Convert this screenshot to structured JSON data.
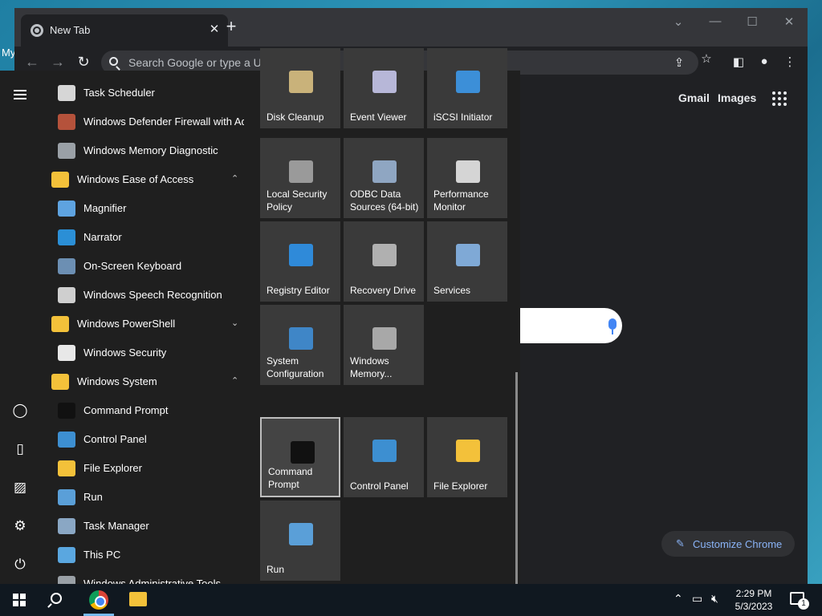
{
  "desktop": {
    "label": "My"
  },
  "browser": {
    "tab_title": "New Tab",
    "tab_close": "✕",
    "new_tab": "+",
    "omnibox_placeholder": "Search Google or type a URL",
    "gmail": "Gmail",
    "images": "Images",
    "customize": "Customize Chrome"
  },
  "start_menu": {
    "apps": [
      {
        "label": "Task Scheduler",
        "icon": "clock-icon",
        "color": "#d6d6d6"
      },
      {
        "label": "Windows Defender Firewall with Ad...",
        "icon": "firewall-icon",
        "color": "#b5523b"
      },
      {
        "label": "Windows Memory Diagnostic",
        "icon": "memory-chip-icon",
        "color": "#9aa0a6"
      },
      {
        "label": "Windows Ease of Access",
        "icon": "folder-icon",
        "color": "#f3c13a",
        "chevron": "⌃"
      },
      {
        "label": "Magnifier",
        "icon": "magnifier-icon",
        "color": "#5ea3e0"
      },
      {
        "label": "Narrator",
        "icon": "narrator-icon",
        "color": "#2b8fd6"
      },
      {
        "label": "On-Screen Keyboard",
        "icon": "keyboard-icon",
        "color": "#6c8fb3"
      },
      {
        "label": "Windows Speech Recognition",
        "icon": "microphone-icon",
        "color": "#cfcfcf"
      },
      {
        "label": "Windows PowerShell",
        "icon": "folder-icon",
        "color": "#f3c13a",
        "chevron": "⌄"
      },
      {
        "label": "Windows Security",
        "icon": "shield-icon",
        "color": "#e8e8e8"
      },
      {
        "label": "Windows System",
        "icon": "folder-icon",
        "color": "#f3c13a",
        "chevron": "⌃"
      },
      {
        "label": "Command Prompt",
        "icon": "terminal-icon",
        "color": "#111111"
      },
      {
        "label": "Control Panel",
        "icon": "control-panel-icon",
        "color": "#3d8fd1"
      },
      {
        "label": "File Explorer",
        "icon": "folder-icon",
        "color": "#f3c13a"
      },
      {
        "label": "Run",
        "icon": "run-icon",
        "color": "#5a9fd8"
      },
      {
        "label": "Task Manager",
        "icon": "task-manager-icon",
        "color": "#8aa7c4"
      },
      {
        "label": "This PC",
        "icon": "computer-icon",
        "color": "#5aa7e0"
      },
      {
        "label": "Windows Administrative Tools",
        "icon": "admin-tools-icon",
        "color": "#9aa0a6"
      }
    ],
    "tiles": [
      {
        "label": "Disk Cleanup",
        "icon": "disk-cleanup-icon",
        "color": "#c9b27a"
      },
      {
        "label": "Event Viewer",
        "icon": "event-viewer-icon",
        "color": "#b7b7d8"
      },
      {
        "label": "iSCSI Initiator",
        "icon": "globe-icon",
        "color": "#3c8fd8"
      },
      {
        "label": "Local Security Policy",
        "icon": "security-policy-icon",
        "color": "#9a9a9a"
      },
      {
        "label": "ODBC Data Sources (64-bit)",
        "icon": "database-icon",
        "color": "#8fa6c2"
      },
      {
        "label": "Performance Monitor",
        "icon": "gauge-icon",
        "color": "#d5d5d5"
      },
      {
        "label": "Registry Editor",
        "icon": "registry-icon",
        "color": "#2f8ad9"
      },
      {
        "label": "Recovery Drive",
        "icon": "drive-icon",
        "color": "#b0b0b0"
      },
      {
        "label": "Services",
        "icon": "gears-icon",
        "color": "#7fa9d6"
      },
      {
        "label": "System Configuration",
        "icon": "system-config-icon",
        "color": "#3f86c7"
      },
      {
        "label": "Windows Memory...",
        "icon": "memory-chip-icon",
        "color": "#a8a8a8"
      },
      {
        "label": "Command Prompt",
        "icon": "terminal-icon",
        "color": "#111111"
      },
      {
        "label": "Control Panel",
        "icon": "control-panel-icon",
        "color": "#3d8fd1"
      },
      {
        "label": "File Explorer",
        "icon": "folder-icon",
        "color": "#f3c13a"
      },
      {
        "label": "Run",
        "icon": "run-icon",
        "color": "#5a9fd8"
      }
    ]
  },
  "taskbar": {
    "time": "2:29 PM",
    "date": "5/3/2023",
    "notifications": "1"
  }
}
